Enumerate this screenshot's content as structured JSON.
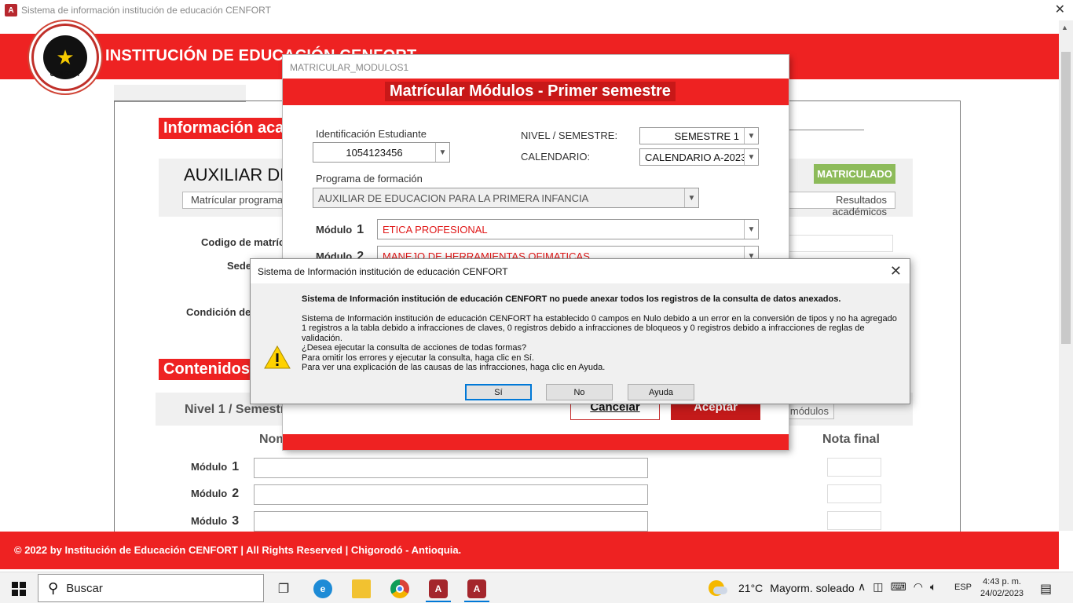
{
  "window": {
    "icon_text": "A",
    "title": "Sistema de información institución de educación CENFORT",
    "close_glyph": "✕"
  },
  "header": {
    "logo_text": "CENFORT",
    "title": "INSTITUCIÓN DE EDUCACIÓN CENFORT"
  },
  "background_form": {
    "section_info": "Información académica",
    "student_name": "AUXILIAR DE EDUCACION PARA LA PRIMERA INFANCIA",
    "btn_matricular": "Matrícular programa",
    "btn_resultados": "Resultados académicos",
    "status_badge": "MATRICULADO",
    "label_codigo": "Codigo de matrícula",
    "label_sede": "Sede",
    "label_condicion": "Condición de",
    "section_contenidos": "Contenidos",
    "nivel_text": "Nivel 1 / Semestre 1",
    "btn_modulos": "módulos",
    "col_nombre": "Nombre",
    "col_nota": "Nota final",
    "module_word": "Módulo",
    "modules": [
      "1",
      "2",
      "3"
    ]
  },
  "modal": {
    "window_title": "MATRICULAR_MODULOS1",
    "heading": "Matrícular Módulos - Primer semestre",
    "id_label": "Identificación Estudiante",
    "id_value": "1054123456",
    "nivel_label": "NIVEL / SEMESTRE:",
    "nivel_value": "SEMESTRE 1",
    "calendario_label": "CALENDARIO:",
    "calendario_value": "CALENDARIO A-2023",
    "programa_label": "Programa de formación",
    "programa_value": "AUXILIAR DE EDUCACION PARA LA PRIMERA INFANCIA",
    "module_word": "Módulo",
    "modules": [
      {
        "num": "1",
        "value": "ETICA PROFESIONAL"
      },
      {
        "num": "2",
        "value": "MANEJO DE HERRAMIENTAS OFIMATICAS"
      }
    ],
    "cancel_label": "Cancelar",
    "ok_label": "Aceptar"
  },
  "dialog": {
    "title": "Sistema de Información institución de educación CENFORT",
    "close_glyph": "✕",
    "headline": "Sistema de Información institución de educación CENFORT no puede anexar todos los registros de la consulta de datos anexados.",
    "body_lines": [
      "Sistema de Información institución de educación CENFORT ha establecido 0 campos en Nulo debido a un error en la conversión de tipos y no ha agregado 1 registros a la tabla debido a infracciones de claves, 0 registros debido a infracciones de bloqueos y 0 registros debido a infracciones de reglas de validación.",
      "¿Desea ejecutar la consulta de acciones de todas formas?",
      "Para omitir los errores y ejecutar la consulta, haga clic en Sí.",
      "Para ver una explicación de las causas de las infracciones, haga clic en Ayuda."
    ],
    "btn_yes": "Sí",
    "btn_no": "No",
    "btn_help": "Ayuda"
  },
  "footer": {
    "text": "© 2022 by Institución de Educación CENFORT | All Rights Reserved | Chigorodó - Antioquia."
  },
  "taskbar": {
    "search_placeholder": "Buscar",
    "weather_temp": "21°C",
    "weather_desc": "Mayorm. soleado",
    "language": "ESP",
    "time": "4:43 p. m.",
    "date": "24/02/2023"
  }
}
